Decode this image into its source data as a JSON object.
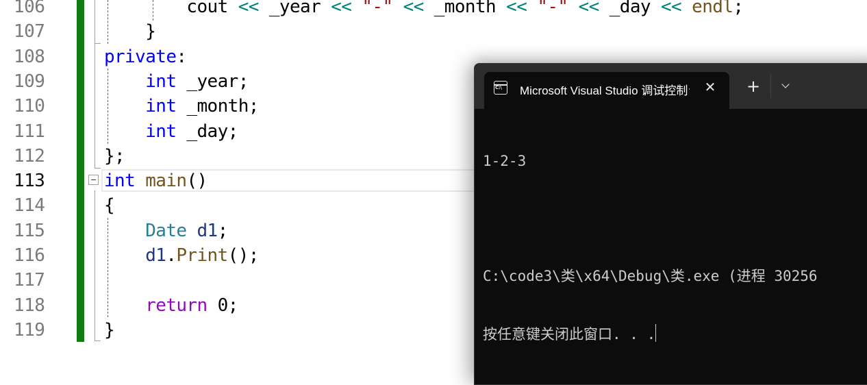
{
  "editor": {
    "current_line": 113,
    "lines": [
      {
        "number": "106",
        "tokens": [
          {
            "t": "        cout ",
            "c": "plain"
          },
          {
            "t": "<<",
            "c": "op"
          },
          {
            "t": " _year ",
            "c": "plain"
          },
          {
            "t": "<<",
            "c": "op"
          },
          {
            "t": " ",
            "c": "plain"
          },
          {
            "t": "\"-\"",
            "c": "str"
          },
          {
            "t": " ",
            "c": "plain"
          },
          {
            "t": "<<",
            "c": "op"
          },
          {
            "t": " _month ",
            "c": "plain"
          },
          {
            "t": "<<",
            "c": "op"
          },
          {
            "t": " ",
            "c": "plain"
          },
          {
            "t": "\"-\"",
            "c": "str"
          },
          {
            "t": " ",
            "c": "plain"
          },
          {
            "t": "<<",
            "c": "op"
          },
          {
            "t": " _day ",
            "c": "plain"
          },
          {
            "t": "<<",
            "c": "op"
          },
          {
            "t": " ",
            "c": "plain"
          },
          {
            "t": "endl",
            "c": "fn"
          },
          {
            "t": ";",
            "c": "plain"
          }
        ]
      },
      {
        "number": "107",
        "tokens": [
          {
            "t": "    }",
            "c": "plain"
          }
        ]
      },
      {
        "number": "108",
        "tokens": [
          {
            "t": "private",
            "c": "kw"
          },
          {
            "t": ":",
            "c": "plain"
          }
        ]
      },
      {
        "number": "109",
        "tokens": [
          {
            "t": "    ",
            "c": "plain"
          },
          {
            "t": "int",
            "c": "kw"
          },
          {
            "t": " _year;",
            "c": "plain"
          }
        ]
      },
      {
        "number": "110",
        "tokens": [
          {
            "t": "    ",
            "c": "plain"
          },
          {
            "t": "int",
            "c": "kw"
          },
          {
            "t": " _month;",
            "c": "plain"
          }
        ]
      },
      {
        "number": "111",
        "tokens": [
          {
            "t": "    ",
            "c": "plain"
          },
          {
            "t": "int",
            "c": "kw"
          },
          {
            "t": " _day;",
            "c": "plain"
          }
        ]
      },
      {
        "number": "112",
        "tokens": [
          {
            "t": "};",
            "c": "plain"
          }
        ]
      },
      {
        "number": "113",
        "tokens": [
          {
            "t": "int",
            "c": "kw"
          },
          {
            "t": " ",
            "c": "plain"
          },
          {
            "t": "main",
            "c": "fn"
          },
          {
            "t": "()",
            "c": "plain"
          }
        ]
      },
      {
        "number": "114",
        "tokens": [
          {
            "t": "{",
            "c": "plain"
          }
        ]
      },
      {
        "number": "115",
        "tokens": [
          {
            "t": "    ",
            "c": "plain"
          },
          {
            "t": "Date",
            "c": "ty"
          },
          {
            "t": " ",
            "c": "plain"
          },
          {
            "t": "d1",
            "c": "var"
          },
          {
            "t": ";",
            "c": "plain"
          }
        ]
      },
      {
        "number": "116",
        "tokens": [
          {
            "t": "    ",
            "c": "plain"
          },
          {
            "t": "d1",
            "c": "var"
          },
          {
            "t": ".",
            "c": "plain"
          },
          {
            "t": "Print",
            "c": "fn"
          },
          {
            "t": "();",
            "c": "plain"
          }
        ]
      },
      {
        "number": "117",
        "tokens": [
          {
            "t": "",
            "c": "plain"
          }
        ]
      },
      {
        "number": "118",
        "tokens": [
          {
            "t": "    ",
            "c": "plain"
          },
          {
            "t": "return",
            "c": "ret"
          },
          {
            "t": " ",
            "c": "plain"
          },
          {
            "t": "0",
            "c": "num"
          },
          {
            "t": ";",
            "c": "plain"
          }
        ]
      },
      {
        "number": "119",
        "tokens": [
          {
            "t": "}",
            "c": "plain"
          }
        ]
      }
    ]
  },
  "terminal": {
    "tab_title": "Microsoft Visual Studio 调试控制台",
    "tab_icon_label": "C:\\",
    "close_glyph": "✕",
    "new_tab_glyph": "+",
    "output": [
      "1-2-3",
      "",
      "C:\\code3\\类\\x64\\Debug\\类.exe (进程 30256",
      "按任意键关闭此窗口. . ."
    ]
  }
}
